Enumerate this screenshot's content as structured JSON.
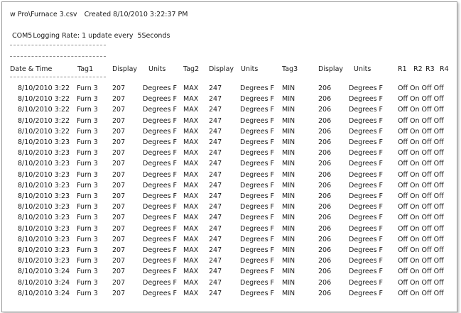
{
  "document": {
    "file_title": "w Pro\\Furnace 3.csv",
    "created": "Created 8/10/2010 3:22:37 PM",
    "port": "COM5",
    "rate_label": "Logging Rate: 1 update every",
    "interval": "5Seconds",
    "separator": "-------------------------------------------------"
  },
  "table": {
    "headers": [
      "Date & Time",
      "Tag1",
      "Display",
      "Units",
      "Tag2",
      "Display",
      "Units",
      "Tag3",
      "Display",
      "Units",
      "R1",
      "R2",
      "R3",
      "R4"
    ],
    "rows": [
      [
        "8/10/2010 3:22",
        "Furn 3",
        "207",
        "Degrees F",
        "MAX",
        "247",
        "Degrees F",
        "MIN",
        "206",
        "Degrees F",
        "Off On  Off Off"
      ],
      [
        "8/10/2010 3:22",
        "Furn 3",
        "207",
        "Degrees F",
        "MAX",
        "247",
        "Degrees F",
        "MIN",
        "206",
        "Degrees F",
        "Off On  Off Off"
      ],
      [
        "8/10/2010 3:22",
        "Furn 3",
        "207",
        "Degrees F",
        "MAX",
        "247",
        "Degrees F",
        "MIN",
        "206",
        "Degrees F",
        "Off On  Off Off"
      ],
      [
        "8/10/2010 3:22",
        "Furn 3",
        "207",
        "Degrees F",
        "MAX",
        "247",
        "Degrees F",
        "MIN",
        "206",
        "Degrees F",
        "Off On  Off Off"
      ],
      [
        "8/10/2010 3:22",
        "Furn 3",
        "207",
        "Degrees F",
        "MAX",
        "247",
        "Degrees F",
        "MIN",
        "206",
        "Degrees F",
        "Off On  Off Off"
      ],
      [
        "8/10/2010 3:23",
        "Furn 3",
        "207",
        "Degrees F",
        "MAX",
        "247",
        "Degrees F",
        "MIN",
        "206",
        "Degrees F",
        "Off On  Off Off"
      ],
      [
        "8/10/2010 3:23",
        "Furn 3",
        "207",
        "Degrees F",
        "MAX",
        "247",
        "Degrees F",
        "MIN",
        "206",
        "Degrees F",
        "Off On  Off Off"
      ],
      [
        "8/10/2010 3:23",
        "Furn 3",
        "207",
        "Degrees F",
        "MAX",
        "247",
        "Degrees F",
        "MIN",
        "206",
        "Degrees F",
        "Off On  Off Off"
      ],
      [
        "8/10/2010 3:23",
        "Furn 3",
        "207",
        "Degrees F",
        "MAX",
        "247",
        "Degrees F",
        "MIN",
        "206",
        "Degrees F",
        "Off On  Off Off"
      ],
      [
        "8/10/2010 3:23",
        "Furn 3",
        "207",
        "Degrees F",
        "MAX",
        "247",
        "Degrees F",
        "MIN",
        "206",
        "Degrees F",
        "Off On  Off Off"
      ],
      [
        "8/10/2010 3:23",
        "Furn 3",
        "207",
        "Degrees F",
        "MAX",
        "247",
        "Degrees F",
        "MIN",
        "206",
        "Degrees F",
        "Off On  Off Off"
      ],
      [
        "8/10/2010 3:23",
        "Furn 3",
        "207",
        "Degrees F",
        "MAX",
        "247",
        "Degrees F",
        "MIN",
        "206",
        "Degrees F",
        "Off On  Off Off"
      ],
      [
        "8/10/2010 3:23",
        "Furn 3",
        "207",
        "Degrees F",
        "MAX",
        "247",
        "Degrees F",
        "MIN",
        "206",
        "Degrees F",
        "Off On  Off Off"
      ],
      [
        "8/10/2010 3:23",
        "Furn 3",
        "207",
        "Degrees F",
        "MAX",
        "247",
        "Degrees F",
        "MIN",
        "206",
        "Degrees F",
        "Off On  Off Off"
      ],
      [
        "8/10/2010 3:23",
        "Furn 3",
        "207",
        "Degrees F",
        "MAX",
        "247",
        "Degrees F",
        "MIN",
        "206",
        "Degrees F",
        "Off On  Off Off"
      ],
      [
        "8/10/2010 3:23",
        "Furn 3",
        "207",
        "Degrees F",
        "MAX",
        "247",
        "Degrees F",
        "MIN",
        "206",
        "Degrees F",
        "Off On  Off Off"
      ],
      [
        "8/10/2010 3:23",
        "Furn 3",
        "207",
        "Degrees F",
        "MAX",
        "247",
        "Degrees F",
        "MIN",
        "206",
        "Degrees F",
        "Off On  Off Off"
      ],
      [
        "8/10/2010 3:24",
        "Furn 3",
        "207",
        "Degrees F",
        "MAX",
        "247",
        "Degrees F",
        "MIN",
        "206",
        "Degrees F",
        "Off On  Off Off"
      ],
      [
        "8/10/2010 3:24",
        "Furn 3",
        "207",
        "Degrees F",
        "MAX",
        "247",
        "Degrees F",
        "MIN",
        "206",
        "Degrees F",
        "Off On  Off Off"
      ],
      [
        "8/10/2010 3:24",
        "Furn 3",
        "207",
        "Degrees F",
        "MAX",
        "247",
        "Degrees F",
        "MIN",
        "206",
        "Degrees F",
        "Off On  Off Off"
      ]
    ]
  }
}
